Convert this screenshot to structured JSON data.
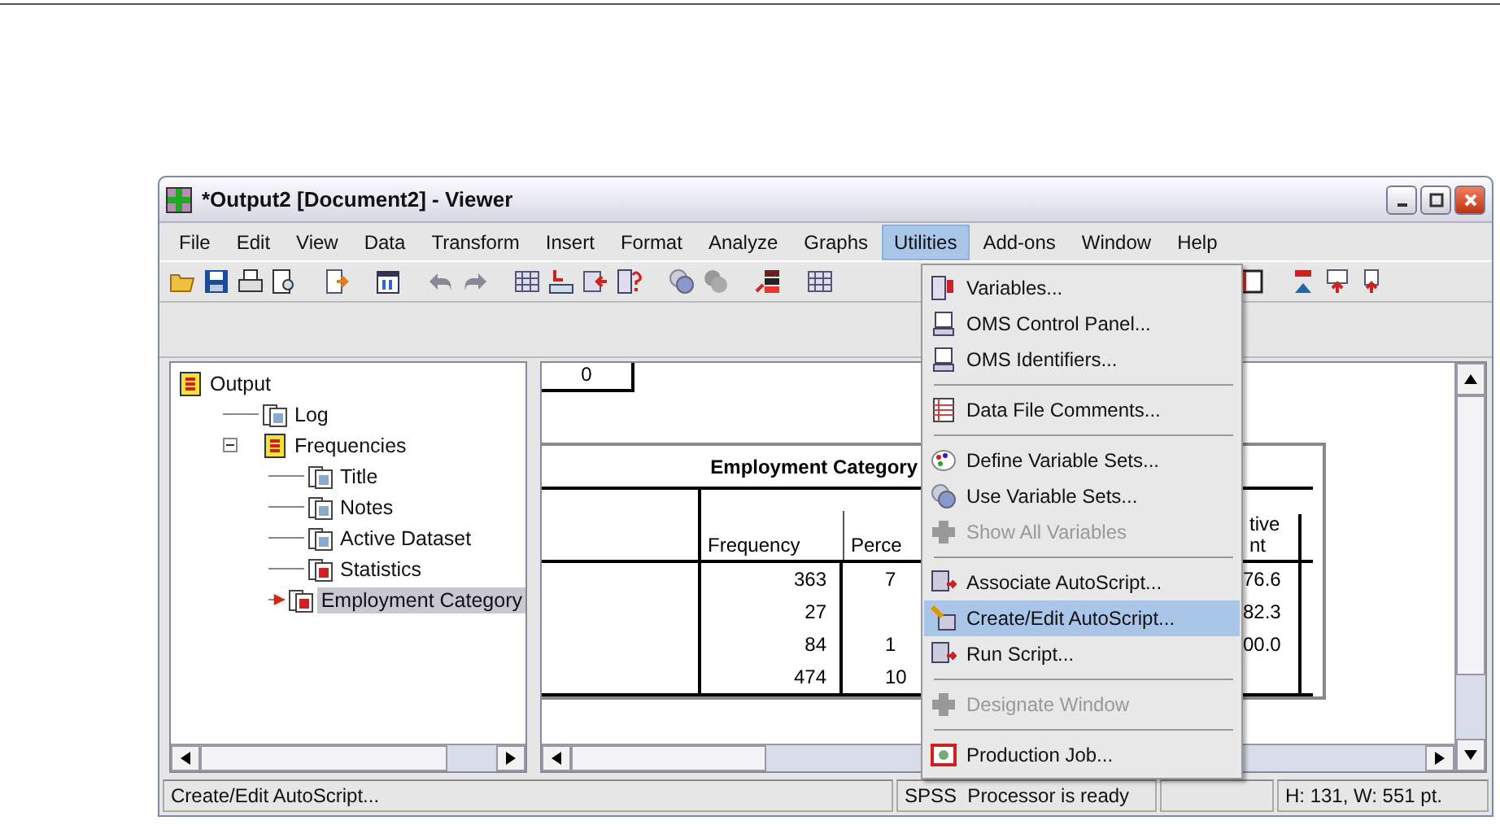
{
  "window": {
    "title": "*Output2 [Document2] - Viewer"
  },
  "menu_bar": [
    {
      "label": "File",
      "selected": false
    },
    {
      "label": "Edit",
      "selected": false
    },
    {
      "label": "View",
      "selected": false
    },
    {
      "label": "Data",
      "selected": false
    },
    {
      "label": "Transform",
      "selected": false
    },
    {
      "label": "Insert",
      "selected": false
    },
    {
      "label": "Format",
      "selected": false
    },
    {
      "label": "Analyze",
      "selected": false
    },
    {
      "label": "Graphs",
      "selected": false
    },
    {
      "label": "Utilities",
      "selected": true
    },
    {
      "label": "Add-ons",
      "selected": false
    },
    {
      "label": "Window",
      "selected": false
    },
    {
      "label": "Help",
      "selected": false
    }
  ],
  "utilities_menu": [
    {
      "kind": "item",
      "label": "Variables...",
      "disabled": false,
      "selected": false
    },
    {
      "kind": "item",
      "label": "OMS Control Panel...",
      "disabled": false,
      "selected": false
    },
    {
      "kind": "item",
      "label": "OMS Identifiers...",
      "disabled": false,
      "selected": false
    },
    {
      "kind": "separator"
    },
    {
      "kind": "item",
      "label": "Data File Comments...",
      "disabled": false,
      "selected": false
    },
    {
      "kind": "separator"
    },
    {
      "kind": "item",
      "label": "Define Variable Sets...",
      "disabled": false,
      "selected": false
    },
    {
      "kind": "item",
      "label": "Use Variable Sets...",
      "disabled": false,
      "selected": false
    },
    {
      "kind": "item",
      "label": "Show All Variables",
      "disabled": true,
      "selected": false
    },
    {
      "kind": "separator"
    },
    {
      "kind": "item",
      "label": "Associate AutoScript...",
      "disabled": false,
      "selected": false
    },
    {
      "kind": "item",
      "label": "Create/Edit AutoScript...",
      "disabled": false,
      "selected": true
    },
    {
      "kind": "item",
      "label": "Run Script...",
      "disabled": false,
      "selected": false
    },
    {
      "kind": "separator"
    },
    {
      "kind": "item",
      "label": "Designate Window",
      "disabled": true,
      "selected": false
    },
    {
      "kind": "separator"
    },
    {
      "kind": "item",
      "label": "Production Job...",
      "disabled": false,
      "selected": false
    }
  ],
  "outline": {
    "label": "Output",
    "selected": false,
    "children": [
      {
        "label": "Log",
        "selected": false
      },
      {
        "label": "Frequencies",
        "selected": false,
        "expanded": true,
        "children": [
          {
            "label": "Title",
            "selected": false
          },
          {
            "label": "Notes",
            "selected": false
          },
          {
            "label": "Active Dataset",
            "selected": false
          },
          {
            "label": "Statistics",
            "selected": false
          },
          {
            "label": "Employment Category",
            "selected": true
          }
        ]
      }
    ]
  },
  "document": {
    "page_number": "0",
    "table": {
      "title": "Employment Category",
      "columns": [
        "Frequency",
        "Perce",
        "tive\nnt"
      ],
      "rows": [
        {
          "frequency": "363",
          "percent": "7",
          "cumulative": "76.6"
        },
        {
          "frequency": "27",
          "cumulative": "82.3"
        },
        {
          "frequency": "84",
          "percent": "1",
          "cumulative": "00.0"
        },
        {
          "frequency": "474",
          "percent": "10"
        }
      ]
    }
  },
  "status_bar": [
    "Create/Edit AutoScript...",
    "SPSS  Processor is ready",
    "H: 131, W: 551 pt."
  ]
}
